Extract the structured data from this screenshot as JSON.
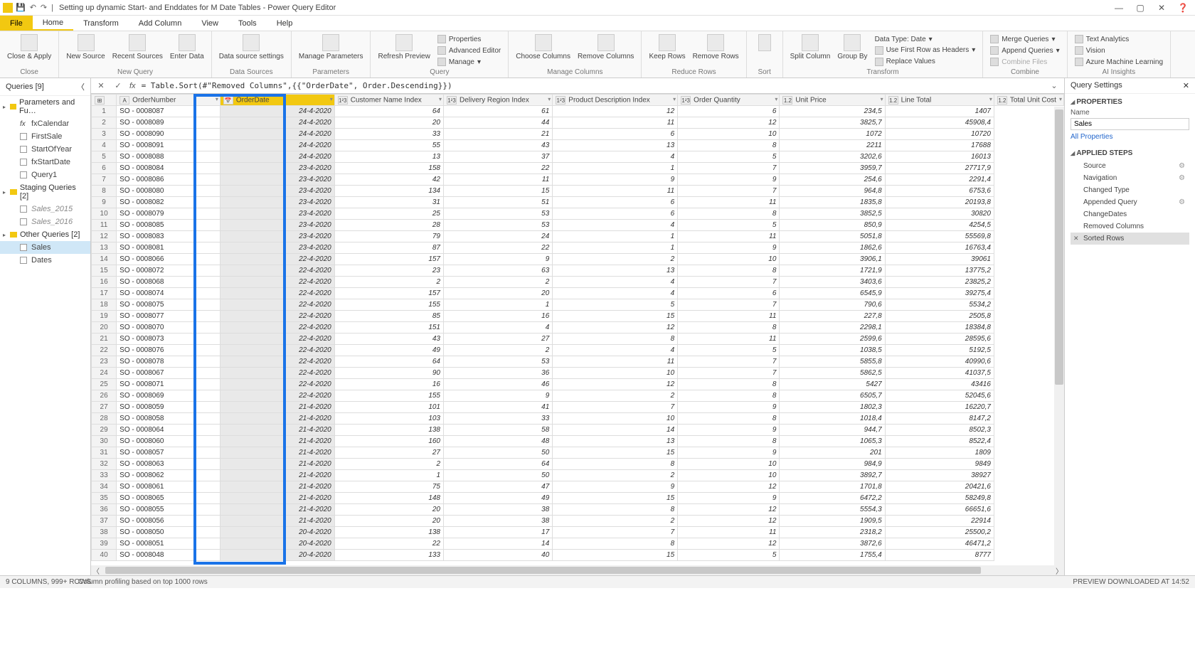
{
  "title": "Setting up dynamic Start- and Enddates for M Date Tables - Power Query Editor",
  "tabs": [
    "File",
    "Home",
    "Transform",
    "Add Column",
    "View",
    "Tools",
    "Help"
  ],
  "activeTab": "Home",
  "ribbon": {
    "close": {
      "label": "Close &\nApply",
      "group": "Close"
    },
    "newquery": {
      "buttons": [
        {
          "label": "New\nSource"
        },
        {
          "label": "Recent\nSources"
        },
        {
          "label": "Enter\nData"
        }
      ],
      "group": "New Query"
    },
    "datasources": {
      "buttons": [
        {
          "label": "Data source\nsettings"
        }
      ],
      "group": "Data Sources"
    },
    "parameters": {
      "buttons": [
        {
          "label": "Manage\nParameters"
        }
      ],
      "group": "Parameters"
    },
    "query": {
      "buttons": [
        {
          "label": "Refresh\nPreview"
        }
      ],
      "items": [
        "Properties",
        "Advanced Editor",
        "Manage"
      ],
      "group": "Query"
    },
    "managecols": {
      "buttons": [
        {
          "label": "Choose\nColumns"
        },
        {
          "label": "Remove\nColumns"
        }
      ],
      "group": "Manage Columns"
    },
    "reducerows": {
      "buttons": [
        {
          "label": "Keep\nRows"
        },
        {
          "label": "Remove\nRows"
        }
      ],
      "group": "Reduce Rows"
    },
    "sort": {
      "buttons": [
        {
          "label": ""
        }
      ],
      "group": "Sort"
    },
    "split": {
      "buttons": [
        {
          "label": "Split\nColumn"
        },
        {
          "label": "Group\nBy"
        }
      ],
      "group": ""
    },
    "transform": {
      "items": [
        "Data Type: Date",
        "Use First Row as Headers",
        "Replace Values"
      ],
      "group": "Transform"
    },
    "combine": {
      "items": [
        "Merge Queries",
        "Append Queries",
        "Combine Files"
      ],
      "group": "Combine"
    },
    "ai": {
      "items": [
        "Text Analytics",
        "Vision",
        "Azure Machine Learning"
      ],
      "group": "AI Insights"
    }
  },
  "queriesPanel": {
    "title": "Queries [9]",
    "groups": [
      {
        "name": "Parameters and Fu…",
        "items": [
          {
            "name": "fxCalendar",
            "type": "fx"
          },
          {
            "name": "FirstSale",
            "type": "table"
          },
          {
            "name": "StartOfYear",
            "type": "table"
          },
          {
            "name": "fxStartDate",
            "type": "table"
          },
          {
            "name": "Query1",
            "type": "table"
          }
        ]
      },
      {
        "name": "Staging Queries [2]",
        "items": [
          {
            "name": "Sales_2015",
            "type": "table",
            "italic": true
          },
          {
            "name": "Sales_2016",
            "type": "table",
            "italic": true
          }
        ]
      },
      {
        "name": "Other Queries [2]",
        "items": [
          {
            "name": "Sales",
            "type": "table",
            "selected": true
          },
          {
            "name": "Dates",
            "type": "table"
          }
        ]
      }
    ]
  },
  "formula": "= Table.Sort(#\"Removed Columns\",{{\"OrderDate\", Order.Descending}})",
  "columns": [
    {
      "name": "",
      "type": "rownum"
    },
    {
      "name": "OrderNumber",
      "type": "ABC"
    },
    {
      "name": "OrderDate",
      "type": "date",
      "highlight": true
    },
    {
      "name": "Customer Name Index",
      "type": "123"
    },
    {
      "name": "Delivery Region Index",
      "type": "123"
    },
    {
      "name": "Product Description Index",
      "type": "123"
    },
    {
      "name": "Order Quantity",
      "type": "123"
    },
    {
      "name": "Unit Price",
      "type": "1.2"
    },
    {
      "name": "Line Total",
      "type": "1.2"
    },
    {
      "name": "Total Unit Cost",
      "type": "1.2"
    }
  ],
  "rows": [
    [
      "1",
      "SO - 0008087",
      "24-4-2020",
      "64",
      "61",
      "12",
      "6",
      "234,5",
      "1407"
    ],
    [
      "2",
      "SO - 0008089",
      "24-4-2020",
      "20",
      "44",
      "11",
      "12",
      "3825,7",
      "45908,4"
    ],
    [
      "3",
      "SO - 0008090",
      "24-4-2020",
      "33",
      "21",
      "6",
      "10",
      "1072",
      "10720"
    ],
    [
      "4",
      "SO - 0008091",
      "24-4-2020",
      "55",
      "43",
      "13",
      "8",
      "2211",
      "17688"
    ],
    [
      "5",
      "SO - 0008088",
      "24-4-2020",
      "13",
      "37",
      "4",
      "5",
      "3202,6",
      "16013"
    ],
    [
      "6",
      "SO - 0008084",
      "23-4-2020",
      "158",
      "22",
      "1",
      "7",
      "3959,7",
      "27717,9"
    ],
    [
      "7",
      "SO - 0008086",
      "23-4-2020",
      "42",
      "11",
      "9",
      "9",
      "254,6",
      "2291,4"
    ],
    [
      "8",
      "SO - 0008080",
      "23-4-2020",
      "134",
      "15",
      "11",
      "7",
      "964,8",
      "6753,6"
    ],
    [
      "9",
      "SO - 0008082",
      "23-4-2020",
      "31",
      "51",
      "6",
      "11",
      "1835,8",
      "20193,8"
    ],
    [
      "10",
      "SO - 0008079",
      "23-4-2020",
      "25",
      "53",
      "6",
      "8",
      "3852,5",
      "30820"
    ],
    [
      "11",
      "SO - 0008085",
      "23-4-2020",
      "28",
      "53",
      "4",
      "5",
      "850,9",
      "4254,5"
    ],
    [
      "12",
      "SO - 0008083",
      "23-4-2020",
      "79",
      "24",
      "1",
      "11",
      "5051,8",
      "55569,8"
    ],
    [
      "13",
      "SO - 0008081",
      "23-4-2020",
      "87",
      "22",
      "1",
      "9",
      "1862,6",
      "16763,4"
    ],
    [
      "14",
      "SO - 0008066",
      "22-4-2020",
      "157",
      "9",
      "2",
      "10",
      "3906,1",
      "39061"
    ],
    [
      "15",
      "SO - 0008072",
      "22-4-2020",
      "23",
      "63",
      "13",
      "8",
      "1721,9",
      "13775,2"
    ],
    [
      "16",
      "SO - 0008068",
      "22-4-2020",
      "2",
      "2",
      "4",
      "7",
      "3403,6",
      "23825,2"
    ],
    [
      "17",
      "SO - 0008074",
      "22-4-2020",
      "157",
      "20",
      "4",
      "6",
      "6545,9",
      "39275,4"
    ],
    [
      "18",
      "SO - 0008075",
      "22-4-2020",
      "155",
      "1",
      "5",
      "7",
      "790,6",
      "5534,2"
    ],
    [
      "19",
      "SO - 0008077",
      "22-4-2020",
      "85",
      "16",
      "15",
      "11",
      "227,8",
      "2505,8"
    ],
    [
      "20",
      "SO - 0008070",
      "22-4-2020",
      "151",
      "4",
      "12",
      "8",
      "2298,1",
      "18384,8"
    ],
    [
      "21",
      "SO - 0008073",
      "22-4-2020",
      "43",
      "27",
      "8",
      "11",
      "2599,6",
      "28595,6"
    ],
    [
      "22",
      "SO - 0008076",
      "22-4-2020",
      "49",
      "2",
      "4",
      "5",
      "1038,5",
      "5192,5"
    ],
    [
      "23",
      "SO - 0008078",
      "22-4-2020",
      "64",
      "53",
      "11",
      "7",
      "5855,8",
      "40990,6"
    ],
    [
      "24",
      "SO - 0008067",
      "22-4-2020",
      "90",
      "36",
      "10",
      "7",
      "5862,5",
      "41037,5"
    ],
    [
      "25",
      "SO - 0008071",
      "22-4-2020",
      "16",
      "46",
      "12",
      "8",
      "5427",
      "43416"
    ],
    [
      "26",
      "SO - 0008069",
      "22-4-2020",
      "155",
      "9",
      "2",
      "8",
      "6505,7",
      "52045,6"
    ],
    [
      "27",
      "SO - 0008059",
      "21-4-2020",
      "101",
      "41",
      "7",
      "9",
      "1802,3",
      "16220,7"
    ],
    [
      "28",
      "SO - 0008058",
      "21-4-2020",
      "103",
      "33",
      "10",
      "8",
      "1018,4",
      "8147,2"
    ],
    [
      "29",
      "SO - 0008064",
      "21-4-2020",
      "138",
      "58",
      "14",
      "9",
      "944,7",
      "8502,3"
    ],
    [
      "30",
      "SO - 0008060",
      "21-4-2020",
      "160",
      "48",
      "13",
      "8",
      "1065,3",
      "8522,4"
    ],
    [
      "31",
      "SO - 0008057",
      "21-4-2020",
      "27",
      "50",
      "15",
      "9",
      "201",
      "1809"
    ],
    [
      "32",
      "SO - 0008063",
      "21-4-2020",
      "2",
      "64",
      "8",
      "10",
      "984,9",
      "9849"
    ],
    [
      "33",
      "SO - 0008062",
      "21-4-2020",
      "1",
      "50",
      "2",
      "10",
      "3892,7",
      "38927"
    ],
    [
      "34",
      "SO - 0008061",
      "21-4-2020",
      "75",
      "47",
      "9",
      "12",
      "1701,8",
      "20421,6"
    ],
    [
      "35",
      "SO - 0008065",
      "21-4-2020",
      "148",
      "49",
      "15",
      "9",
      "6472,2",
      "58249,8"
    ],
    [
      "36",
      "SO - 0008055",
      "21-4-2020",
      "20",
      "38",
      "8",
      "12",
      "5554,3",
      "66651,6"
    ],
    [
      "37",
      "SO - 0008056",
      "21-4-2020",
      "20",
      "38",
      "2",
      "12",
      "1909,5",
      "22914"
    ],
    [
      "38",
      "SO - 0008050",
      "20-4-2020",
      "138",
      "17",
      "7",
      "11",
      "2318,2",
      "25500,2"
    ],
    [
      "39",
      "SO - 0008051",
      "20-4-2020",
      "22",
      "14",
      "8",
      "12",
      "3872,6",
      "46471,2"
    ],
    [
      "40",
      "SO - 0008048",
      "20-4-2020",
      "133",
      "40",
      "15",
      "5",
      "1755,4",
      "8777"
    ]
  ],
  "settings": {
    "title": "Query Settings",
    "properties": {
      "title": "PROPERTIES",
      "nameLabel": "Name",
      "name": "Sales",
      "link": "All Properties"
    },
    "steps": {
      "title": "APPLIED STEPS",
      "items": [
        {
          "name": "Source",
          "gear": true
        },
        {
          "name": "Navigation",
          "gear": true
        },
        {
          "name": "Changed Type"
        },
        {
          "name": "Appended Query",
          "gear": true
        },
        {
          "name": "ChangeDates"
        },
        {
          "name": "Removed Columns"
        },
        {
          "name": "Sorted Rows",
          "selected": true
        }
      ]
    }
  },
  "statusbar": {
    "left": "9 COLUMNS, 999+ ROWS",
    "middle": "Column profiling based on top 1000 rows",
    "right": "PREVIEW DOWNLOADED AT 14:52"
  }
}
